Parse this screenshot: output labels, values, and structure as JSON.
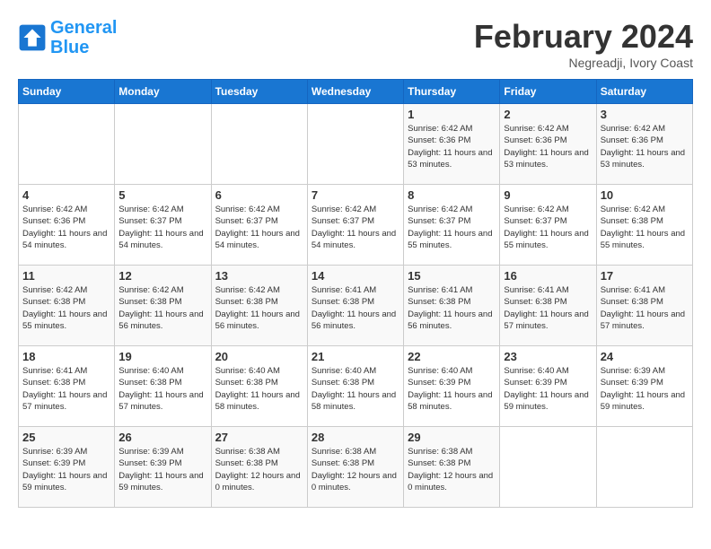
{
  "header": {
    "logo_line1": "General",
    "logo_line2": "Blue",
    "month": "February 2024",
    "location": "Negreadji, Ivory Coast"
  },
  "weekdays": [
    "Sunday",
    "Monday",
    "Tuesday",
    "Wednesday",
    "Thursday",
    "Friday",
    "Saturday"
  ],
  "weeks": [
    [
      {
        "day": "",
        "info": ""
      },
      {
        "day": "",
        "info": ""
      },
      {
        "day": "",
        "info": ""
      },
      {
        "day": "",
        "info": ""
      },
      {
        "day": "1",
        "info": "Sunrise: 6:42 AM\nSunset: 6:36 PM\nDaylight: 11 hours\nand 53 minutes."
      },
      {
        "day": "2",
        "info": "Sunrise: 6:42 AM\nSunset: 6:36 PM\nDaylight: 11 hours\nand 53 minutes."
      },
      {
        "day": "3",
        "info": "Sunrise: 6:42 AM\nSunset: 6:36 PM\nDaylight: 11 hours\nand 53 minutes."
      }
    ],
    [
      {
        "day": "4",
        "info": "Sunrise: 6:42 AM\nSunset: 6:36 PM\nDaylight: 11 hours\nand 54 minutes."
      },
      {
        "day": "5",
        "info": "Sunrise: 6:42 AM\nSunset: 6:37 PM\nDaylight: 11 hours\nand 54 minutes."
      },
      {
        "day": "6",
        "info": "Sunrise: 6:42 AM\nSunset: 6:37 PM\nDaylight: 11 hours\nand 54 minutes."
      },
      {
        "day": "7",
        "info": "Sunrise: 6:42 AM\nSunset: 6:37 PM\nDaylight: 11 hours\nand 54 minutes."
      },
      {
        "day": "8",
        "info": "Sunrise: 6:42 AM\nSunset: 6:37 PM\nDaylight: 11 hours\nand 55 minutes."
      },
      {
        "day": "9",
        "info": "Sunrise: 6:42 AM\nSunset: 6:37 PM\nDaylight: 11 hours\nand 55 minutes."
      },
      {
        "day": "10",
        "info": "Sunrise: 6:42 AM\nSunset: 6:38 PM\nDaylight: 11 hours\nand 55 minutes."
      }
    ],
    [
      {
        "day": "11",
        "info": "Sunrise: 6:42 AM\nSunset: 6:38 PM\nDaylight: 11 hours\nand 55 minutes."
      },
      {
        "day": "12",
        "info": "Sunrise: 6:42 AM\nSunset: 6:38 PM\nDaylight: 11 hours\nand 56 minutes."
      },
      {
        "day": "13",
        "info": "Sunrise: 6:42 AM\nSunset: 6:38 PM\nDaylight: 11 hours\nand 56 minutes."
      },
      {
        "day": "14",
        "info": "Sunrise: 6:41 AM\nSunset: 6:38 PM\nDaylight: 11 hours\nand 56 minutes."
      },
      {
        "day": "15",
        "info": "Sunrise: 6:41 AM\nSunset: 6:38 PM\nDaylight: 11 hours\nand 56 minutes."
      },
      {
        "day": "16",
        "info": "Sunrise: 6:41 AM\nSunset: 6:38 PM\nDaylight: 11 hours\nand 57 minutes."
      },
      {
        "day": "17",
        "info": "Sunrise: 6:41 AM\nSunset: 6:38 PM\nDaylight: 11 hours\nand 57 minutes."
      }
    ],
    [
      {
        "day": "18",
        "info": "Sunrise: 6:41 AM\nSunset: 6:38 PM\nDaylight: 11 hours\nand 57 minutes."
      },
      {
        "day": "19",
        "info": "Sunrise: 6:40 AM\nSunset: 6:38 PM\nDaylight: 11 hours\nand 57 minutes."
      },
      {
        "day": "20",
        "info": "Sunrise: 6:40 AM\nSunset: 6:38 PM\nDaylight: 11 hours\nand 58 minutes."
      },
      {
        "day": "21",
        "info": "Sunrise: 6:40 AM\nSunset: 6:38 PM\nDaylight: 11 hours\nand 58 minutes."
      },
      {
        "day": "22",
        "info": "Sunrise: 6:40 AM\nSunset: 6:39 PM\nDaylight: 11 hours\nand 58 minutes."
      },
      {
        "day": "23",
        "info": "Sunrise: 6:40 AM\nSunset: 6:39 PM\nDaylight: 11 hours\nand 59 minutes."
      },
      {
        "day": "24",
        "info": "Sunrise: 6:39 AM\nSunset: 6:39 PM\nDaylight: 11 hours\nand 59 minutes."
      }
    ],
    [
      {
        "day": "25",
        "info": "Sunrise: 6:39 AM\nSunset: 6:39 PM\nDaylight: 11 hours\nand 59 minutes."
      },
      {
        "day": "26",
        "info": "Sunrise: 6:39 AM\nSunset: 6:39 PM\nDaylight: 11 hours\nand 59 minutes."
      },
      {
        "day": "27",
        "info": "Sunrise: 6:38 AM\nSunset: 6:38 PM\nDaylight: 12 hours\nand 0 minutes."
      },
      {
        "day": "28",
        "info": "Sunrise: 6:38 AM\nSunset: 6:38 PM\nDaylight: 12 hours\nand 0 minutes."
      },
      {
        "day": "29",
        "info": "Sunrise: 6:38 AM\nSunset: 6:38 PM\nDaylight: 12 hours\nand 0 minutes."
      },
      {
        "day": "",
        "info": ""
      },
      {
        "day": "",
        "info": ""
      }
    ]
  ]
}
